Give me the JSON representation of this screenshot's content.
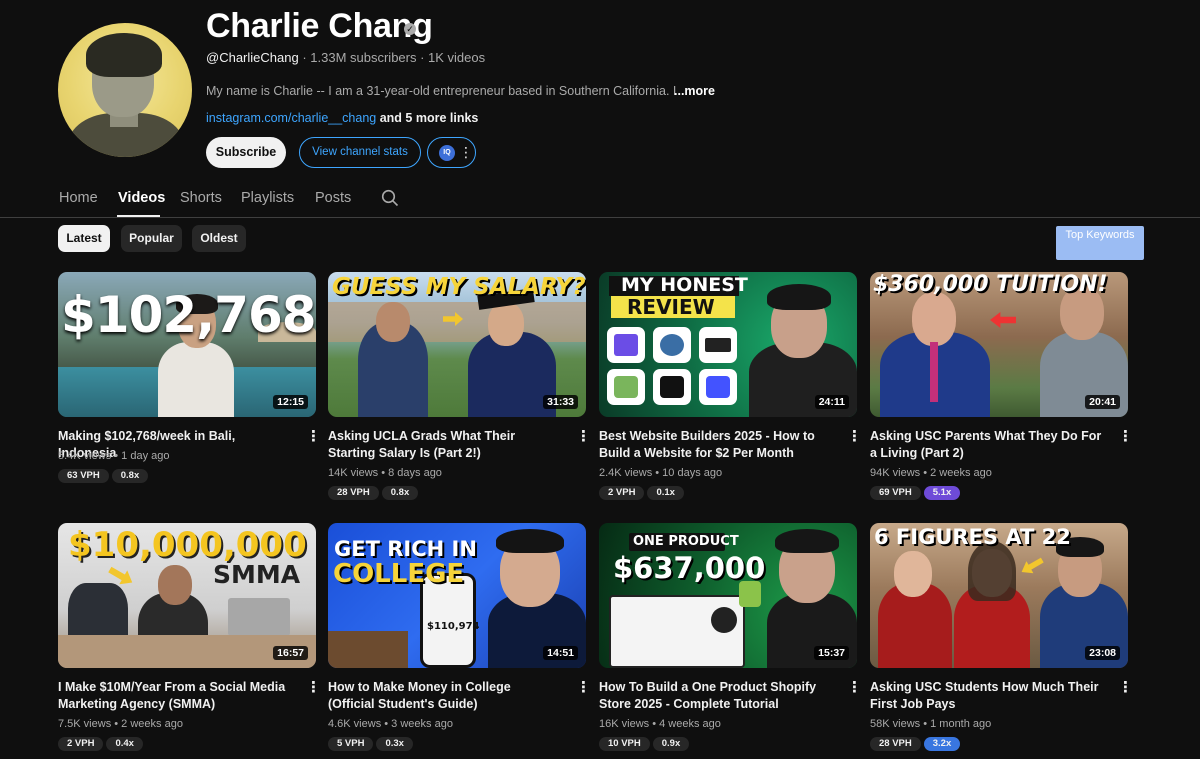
{
  "channel": {
    "name": "Charlie Chang",
    "handle": "@CharlieChang",
    "stats": "· 1.33M subscribers · 1K videos",
    "description": "My name is Charlie -- I am a 31-year-old entrepreneur based in Southern California. I run n",
    "more": "...more",
    "link": "instagram.com/charlie__chang",
    "more_links": "and 5 more links",
    "subscribe_label": "Subscribe",
    "stats_button_label": "View channel stats",
    "ext_badge": "IQ"
  },
  "tabs": [
    "Home",
    "Videos",
    "Shorts",
    "Playlists",
    "Posts"
  ],
  "filters": [
    "Latest",
    "Popular",
    "Oldest"
  ],
  "top_keywords_label": "Top Keywords",
  "videos": [
    {
      "thumb_text": "$102,768",
      "duration": "12:15",
      "title": "Making $102,768/week in Bali, Indonesia",
      "views": "5.4K views",
      "age": "1 day ago",
      "vph": "63 VPH",
      "mult": "0.8x"
    },
    {
      "thumb_text": "GUESS MY SALARY?",
      "duration": "31:33",
      "title": "Asking UCLA Grads What Their Starting Salary Is (Part 2!)",
      "views": "14K views",
      "age": "8 days ago",
      "vph": "28 VPH",
      "mult": "0.8x"
    },
    {
      "thumb_text": "MY HONEST",
      "thumb_text2": "REVIEW",
      "duration": "24:11",
      "title": "Best Website Builders 2025 - How to Build a Website for $2 Per Month",
      "views": "2.4K views",
      "age": "10 days ago",
      "vph": "2 VPH",
      "mult": "0.1x"
    },
    {
      "thumb_text": "$360,000 TUITION!",
      "duration": "20:41",
      "title": "Asking USC Parents What They Do For a Living (Part 2)",
      "views": "94K views",
      "age": "2 weeks ago",
      "vph": "69 VPH",
      "mult": "5.1x"
    },
    {
      "thumb_text": "$10,000,000",
      "thumb_text2": "SMMA",
      "duration": "16:57",
      "title": "I Make $10M/Year From a Social Media Marketing Agency (SMMA)",
      "views": "7.5K views",
      "age": "2 weeks ago",
      "vph": "2 VPH",
      "mult": "0.4x"
    },
    {
      "thumb_text": "GET RICH IN",
      "thumb_text2": "COLLEGE",
      "thumb_text3": "$110,974",
      "duration": "14:51",
      "title": "How to Make Money in College (Official Student's Guide)",
      "views": "4.6K views",
      "age": "3 weeks ago",
      "vph": "5 VPH",
      "mult": "0.3x"
    },
    {
      "thumb_text": "ONE PRODUCT",
      "thumb_text2": "$637,000",
      "duration": "15:37",
      "title": "How To Build a One Product Shopify Store 2025 - Complete Tutorial",
      "views": "16K views",
      "age": "4 weeks ago",
      "vph": "10 VPH",
      "mult": "0.9x"
    },
    {
      "thumb_text": "6 FIGURES AT 22",
      "duration": "23:08",
      "title": "Asking USC Students How Much Their First Job Pays",
      "views": "58K views",
      "age": "1 month ago",
      "vph": "28 VPH",
      "mult": "3.2x"
    }
  ],
  "colors": {
    "background": "#0f0f0f",
    "accent_blue": "#3ea6ff",
    "badge_purple": "#6e4bd8",
    "badge_blue": "#3976e0"
  },
  "icons": {
    "verified": "verified-check-icon",
    "search": "search-icon",
    "menu": "more-vert-icon"
  }
}
